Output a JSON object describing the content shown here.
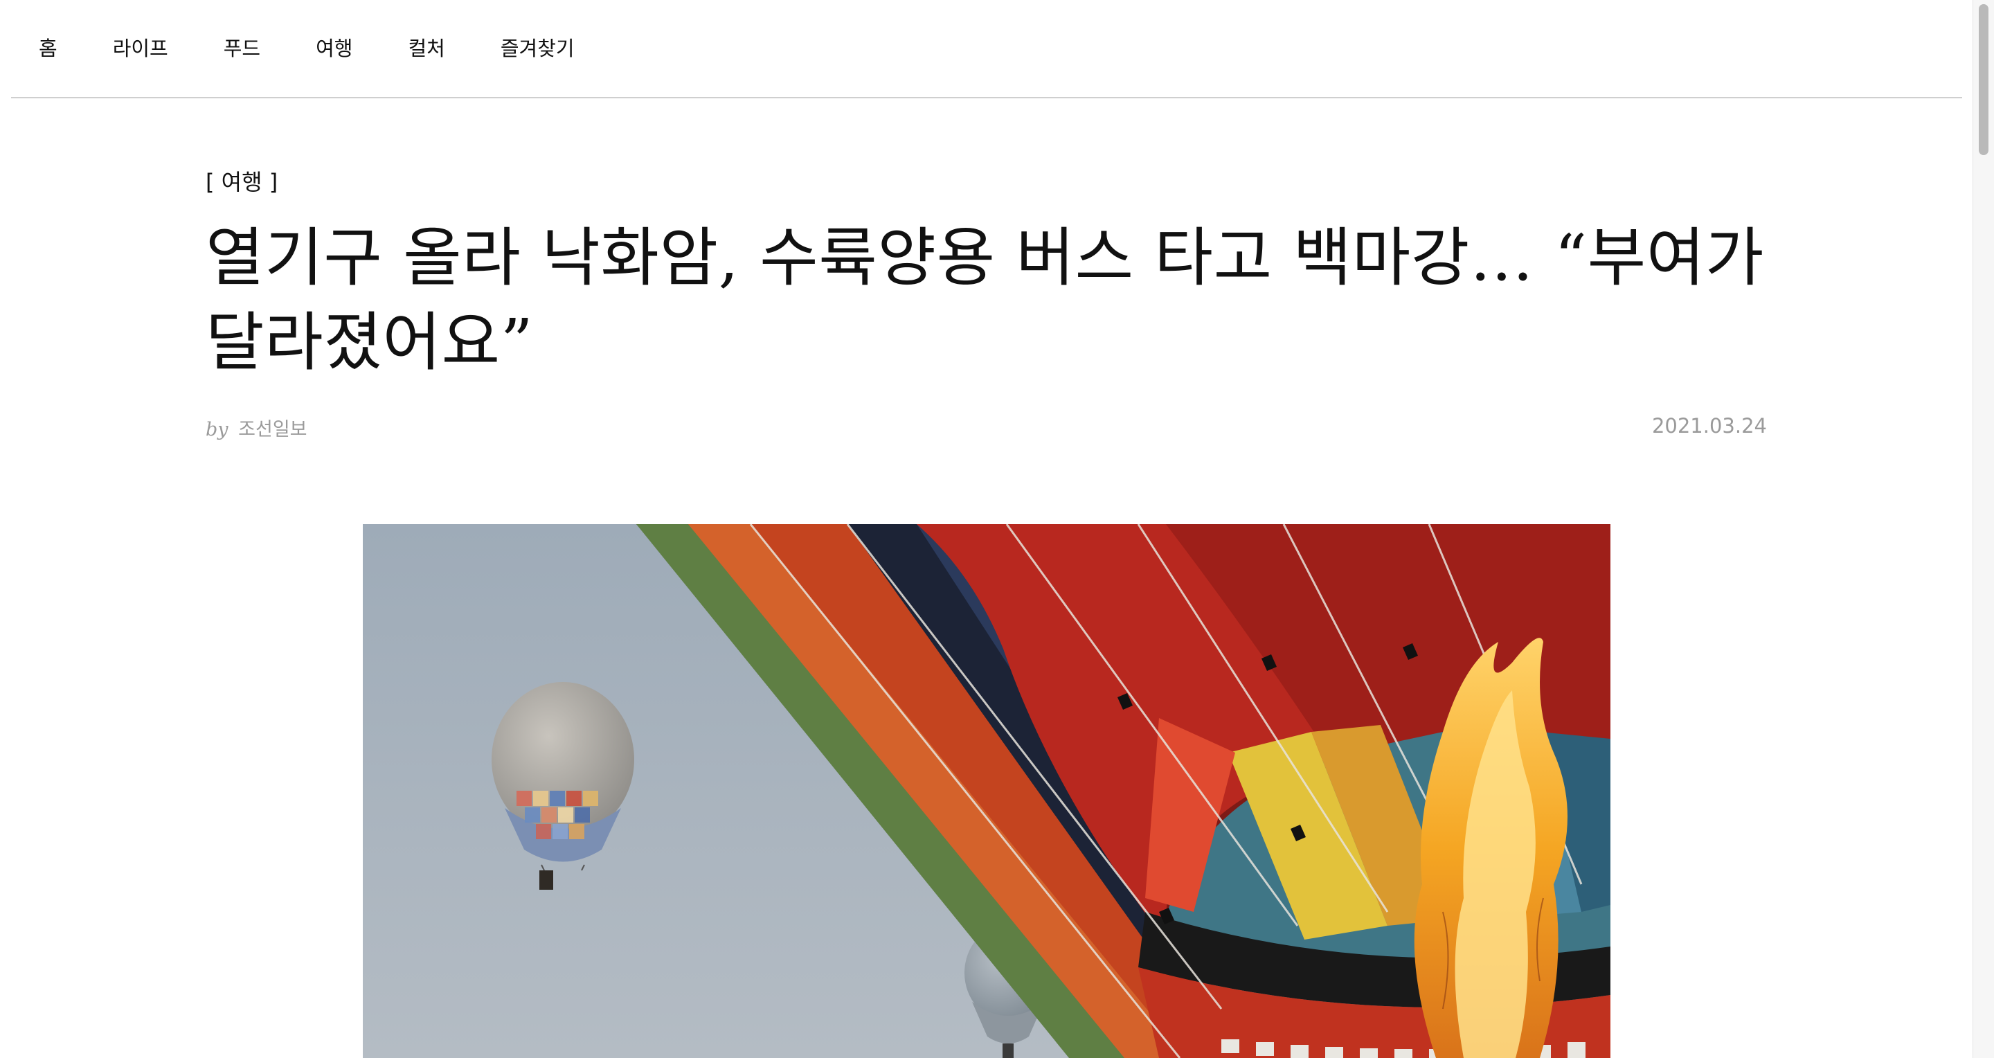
{
  "nav": {
    "items": [
      {
        "label": "홈"
      },
      {
        "label": "라이프"
      },
      {
        "label": "푸드"
      },
      {
        "label": "여행"
      },
      {
        "label": "컬처"
      },
      {
        "label": "즐겨찾기"
      }
    ]
  },
  "article": {
    "category": "[ 여행 ]",
    "title": "열기구 올라 낙화암, 수륙양용 버스 타고 백마강… “부여가 달라졌어요”",
    "byline_prefix": "by",
    "author": "조선일보",
    "date": "2021.03.24"
  },
  "colors": {
    "sky": "#a9b4bf",
    "envelope_red": "#b8281f",
    "flame": "#f5a623",
    "meta_gray": "#9a9a9a"
  },
  "icons": {
    "scrollbar": "vertical-scrollbar"
  }
}
